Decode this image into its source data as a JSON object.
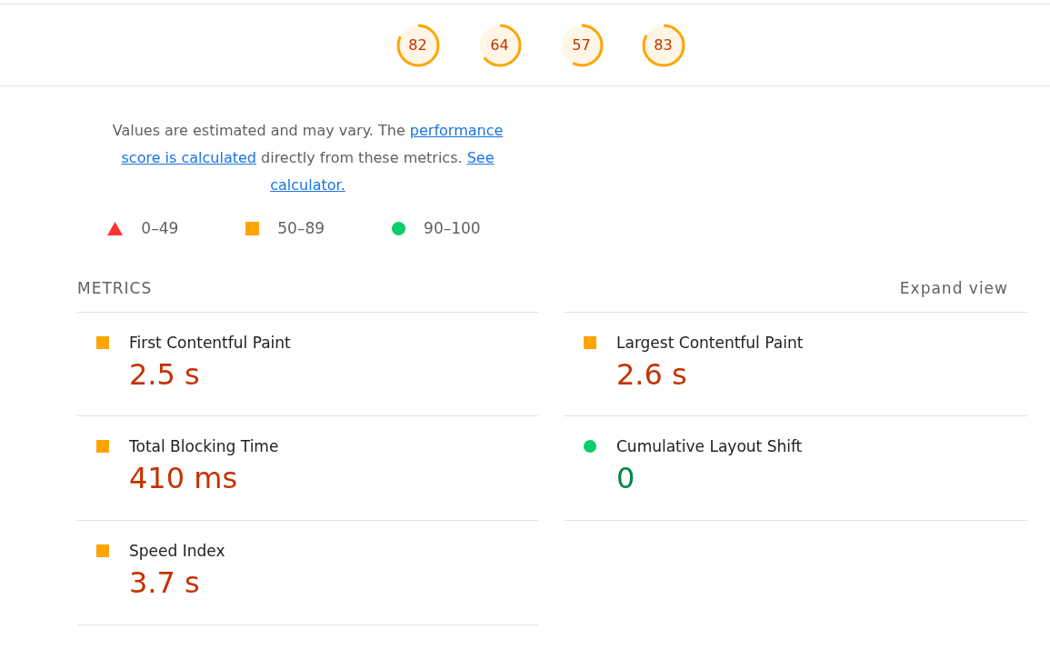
{
  "gauges": [
    {
      "score": "82",
      "kind": "average"
    },
    {
      "score": "64",
      "kind": "average"
    },
    {
      "score": "57",
      "kind": "average"
    },
    {
      "score": "83",
      "kind": "average"
    }
  ],
  "description": [
    {
      "text": "Values are estimated and may vary. The "
    },
    {
      "link": "performance"
    },
    {
      "link": "score is calculated"
    },
    {
      "text": " directly from these metrics. "
    },
    {
      "link": "See"
    },
    {
      "link": "calculator."
    }
  ],
  "legend": [
    {
      "kind": "fail",
      "label": "0–49"
    },
    {
      "kind": "average",
      "label": "50–89"
    },
    {
      "kind": "pass",
      "label": "90–100"
    }
  ],
  "metrics_header": {
    "title": "METRICS",
    "toggle": "Expand view"
  },
  "metrics": [
    {
      "name": "First Contentful Paint",
      "value": "2.5 s",
      "kind": "average"
    },
    {
      "name": "Largest Contentful Paint",
      "value": "2.6 s",
      "kind": "average"
    },
    {
      "name": "Total Blocking Time",
      "value": "410 ms",
      "kind": "average"
    },
    {
      "name": "Cumulative Layout Shift",
      "value": "0",
      "kind": "pass"
    },
    {
      "name": "Speed Index",
      "value": "3.7 s",
      "kind": "average"
    }
  ]
}
